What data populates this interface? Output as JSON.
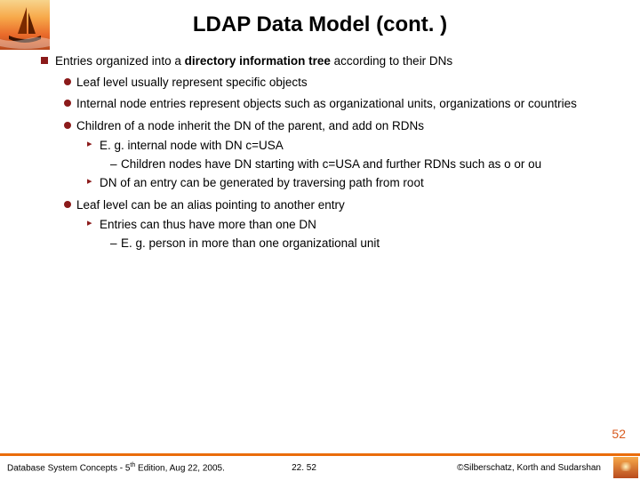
{
  "title": "LDAP Data Model (cont. )",
  "main": {
    "intro_pre": "Entries organized into a ",
    "intro_bold": "directory information tree",
    "intro_post": " according to their DNs",
    "b1": "Leaf level usually represent specific objects",
    "b2": "Internal node entries represent objects such as organizational units, organizations or countries",
    "b3": "Children of a node inherit the DN of the parent, and add on RDNs",
    "b3a": "E. g. internal node with DN c=USA",
    "b3a1": "Children nodes have DN starting with c=USA and further RDNs such as o or ou",
    "b3b": "DN of an entry can be generated by traversing path from root",
    "b4": "Leaf level can be an alias pointing to another entry",
    "b4a": "Entries can thus have more than one DN",
    "b4a1": "E. g. person in more than one organizational unit"
  },
  "slideNumber": "52",
  "footer": {
    "left_pre": "Database System Concepts - 5",
    "left_sup": "th",
    "left_post": " Edition, Aug 22, 2005.",
    "center": "22. 52",
    "right": "©Silberschatz, Korth and Sudarshan"
  }
}
